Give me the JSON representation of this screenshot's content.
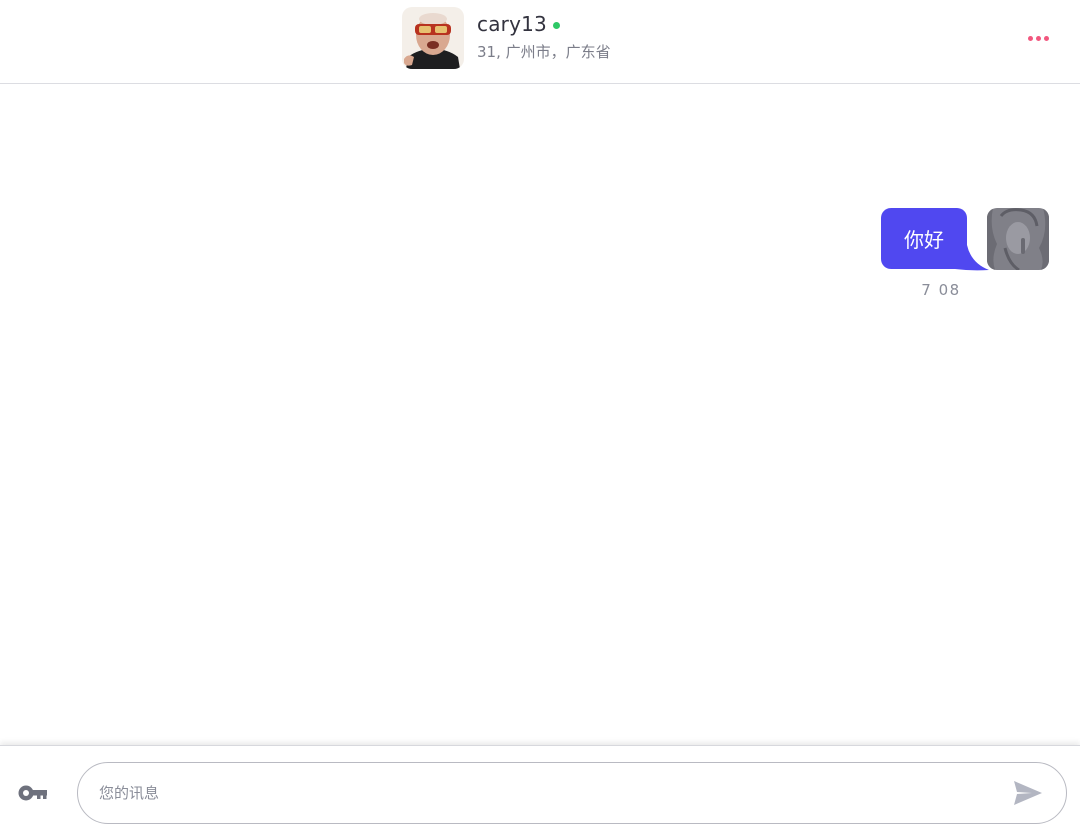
{
  "header": {
    "contact_name": "cary13",
    "contact_subtitle": "31, 广州市，广东省",
    "online_color": "#2ec866",
    "more_icon": "more-horizontal-icon",
    "accent": "#f2577e"
  },
  "messages": [
    {
      "sender": "self",
      "text": "你好",
      "time": "7 08",
      "bubble_color": "#5048f0"
    }
  ],
  "composer": {
    "placeholder": "您的讯息",
    "value": "",
    "left_icon": "key-icon",
    "send_icon": "send-icon"
  }
}
